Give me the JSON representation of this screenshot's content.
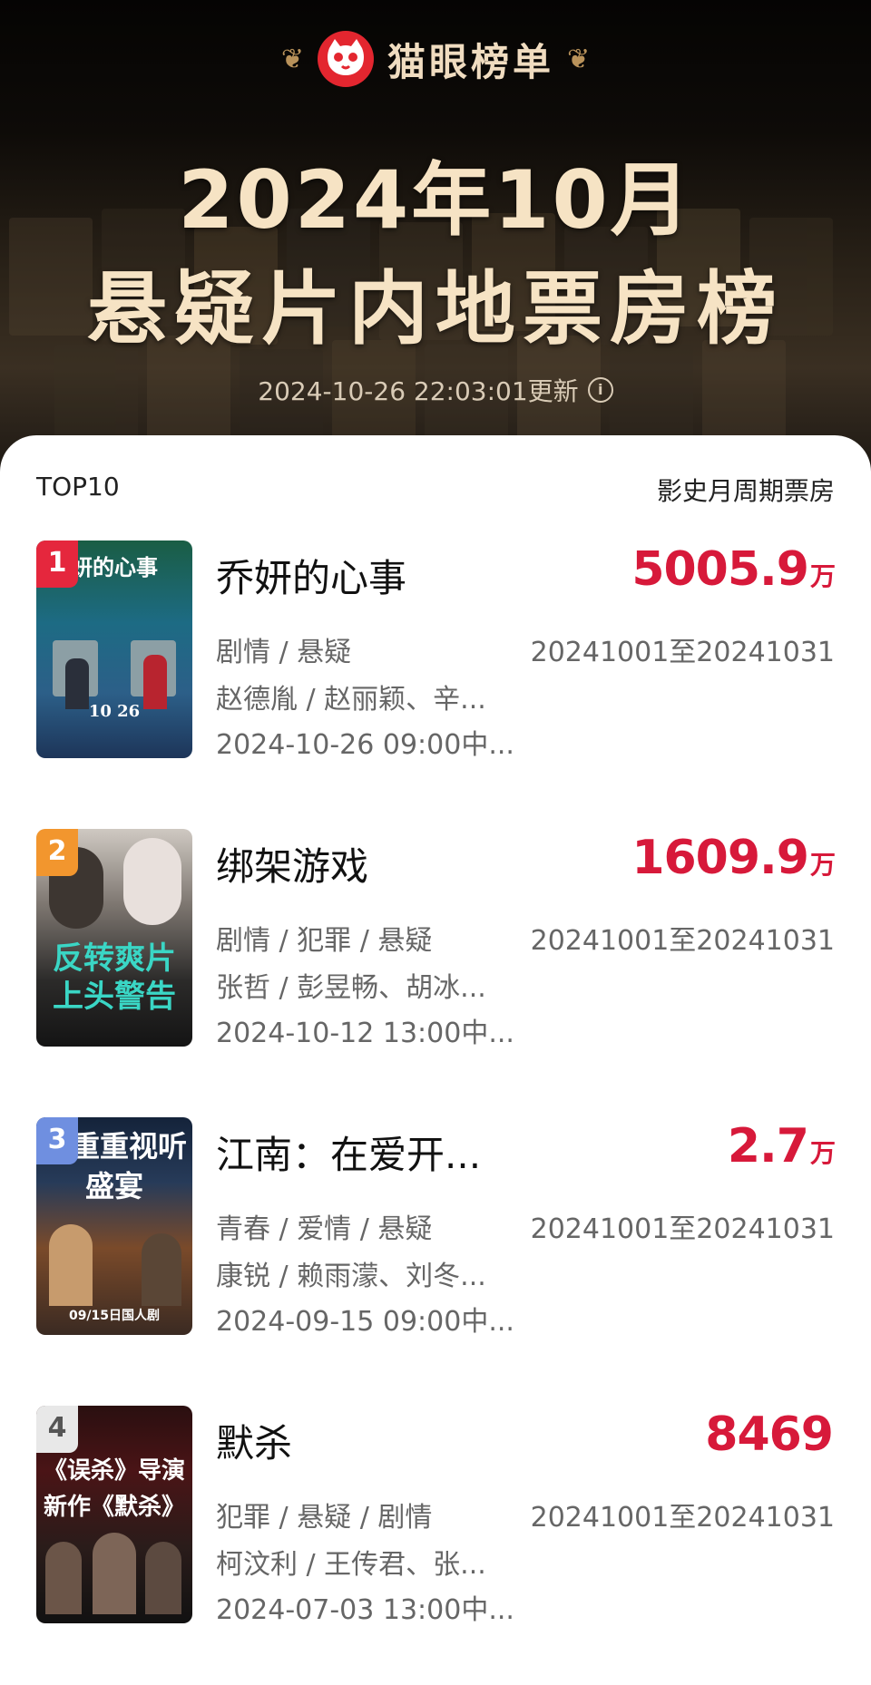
{
  "brand": {
    "name": "猫眼榜单",
    "logo_icon": "cat-face-icon"
  },
  "title_line1": "2024年10月",
  "title_line2": "悬疑片内地票房榜",
  "update_text": "2024-10-26 22:03:01更新",
  "info_icon": "i",
  "list_label": "TOP10",
  "list_header_right": "影史月周期票房",
  "colors": {
    "accent": "#d7193a",
    "gold_text": "#f6e3c4"
  },
  "items": [
    {
      "rank": "1",
      "title": "乔妍的心事",
      "box": "5005.9",
      "unit": "万",
      "genres": "剧情 / 悬疑",
      "cast": "赵德胤 / 赵丽颖、辛...",
      "release": "2024-10-26 09:00中...",
      "period": "20241001至20241031"
    },
    {
      "rank": "2",
      "title": "绑架游戏",
      "box": "1609.9",
      "unit": "万",
      "genres": "剧情 / 犯罪 / 悬疑",
      "cast": "张哲 / 彭昱畅、胡冰...",
      "release": "2024-10-12 13:00中...",
      "period": "20241001至20241031"
    },
    {
      "rank": "3",
      "title": "江南：在爱开...",
      "box": "2.7",
      "unit": "万",
      "genres": "青春 / 爱情 / 悬疑",
      "cast": "康锐 / 赖雨濛、刘冬...",
      "release": "2024-09-15 09:00中...",
      "period": "20241001至20241031"
    },
    {
      "rank": "4",
      "title": "默杀",
      "box": "8469",
      "unit": "",
      "genres": "犯罪 / 悬疑 / 剧情",
      "cast": "柯汶利 / 王传君、张...",
      "release": "2024-07-03 13:00中...",
      "period": "20241001至20241031"
    }
  ],
  "poster_text": {
    "p1_top": "妍的心事",
    "p1_date": "10 26",
    "p2": "反转爽片上头警告",
    "p3": "疑重重视听盛宴",
    "p3_date": "09/15日国人剧",
    "p4": "《误杀》导演新作《默杀》"
  }
}
